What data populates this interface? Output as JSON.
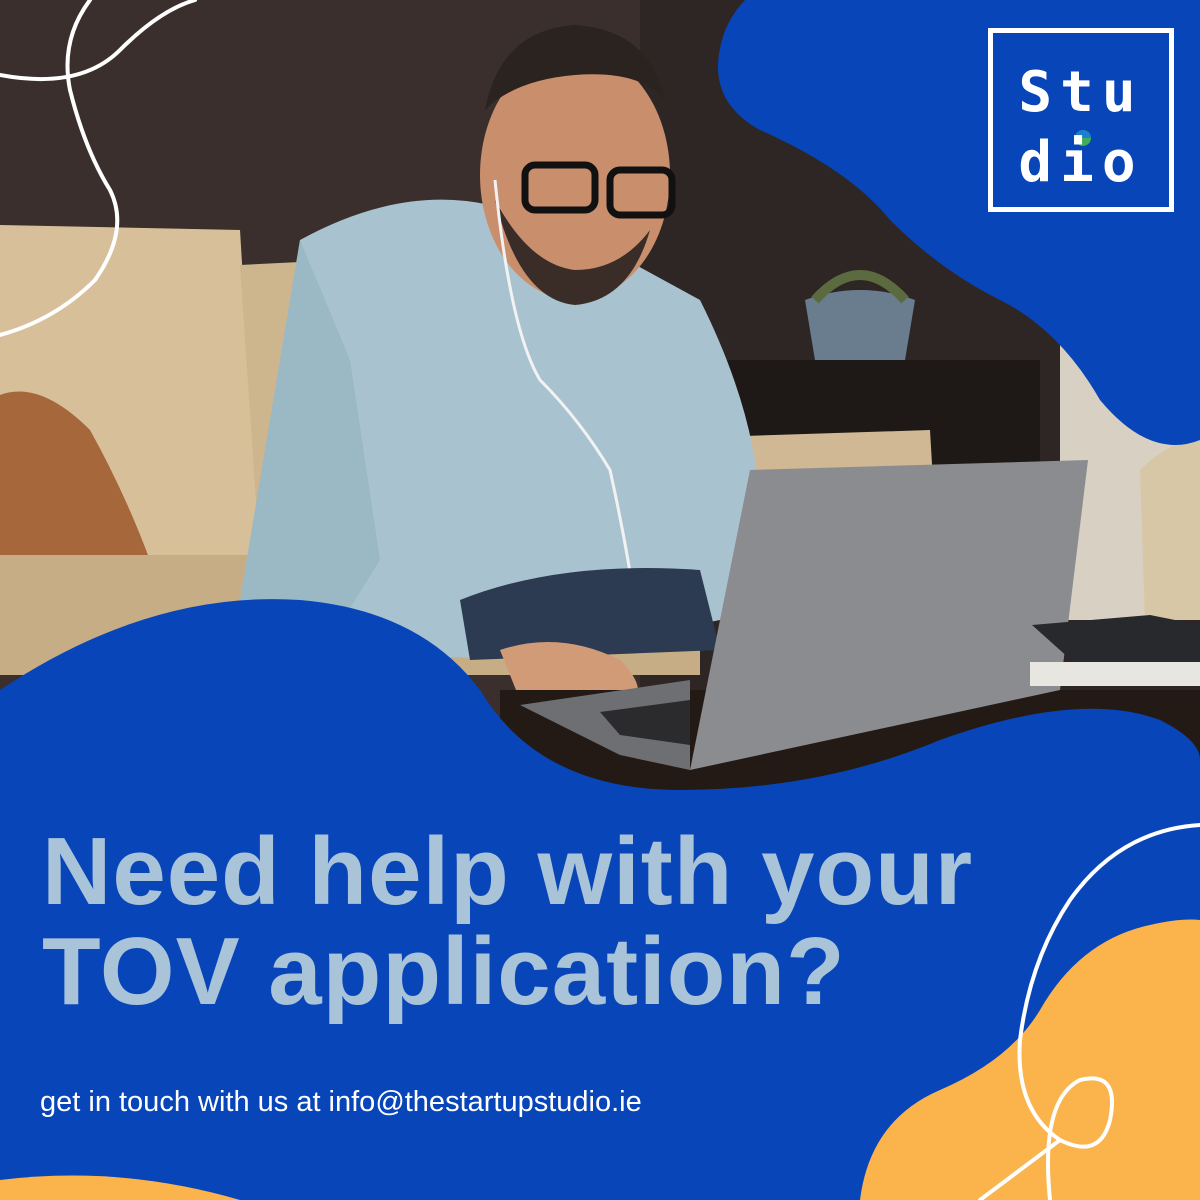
{
  "brand": {
    "logo_line1": "Stu",
    "logo_line2": "dio"
  },
  "headline": {
    "line1": "Need help with your",
    "line2": "TOV application?"
  },
  "contact": {
    "text": "get in touch with us at info@thestartupstudio.ie"
  },
  "photo": {
    "subject": "smiling man with glasses and earphones using a laptop on a sofa"
  },
  "colors": {
    "brand_blue": "#0845b8",
    "accent_orange": "#fbb34c",
    "headline_text": "#a9c3d9",
    "logo_accent_green": "#3fae5a"
  }
}
